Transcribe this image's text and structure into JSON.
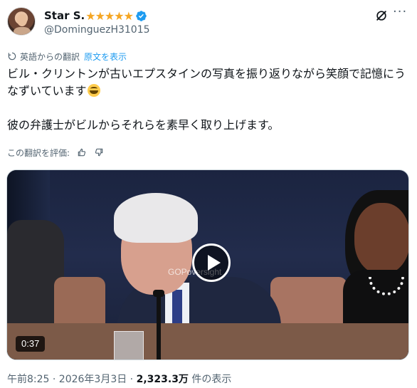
{
  "header": {
    "display_name": "Star S.",
    "stars": "★★★★★",
    "handle": "@DominguezH31015",
    "verified_color": "#1d9bf0"
  },
  "translation": {
    "label": "英語からの翻訳",
    "show_original": "原文を表示"
  },
  "tweet": {
    "line1": "ビル・クリントンが古いエプスタインの写真を振り返りながら笑顔で記憶にうなずいています",
    "line2": "彼の弁護士がビルからそれらを素早く取り上げます。"
  },
  "rating": {
    "label": "この翻訳を評価:"
  },
  "video": {
    "duration": "0:37",
    "watermark": "GOPoversight"
  },
  "meta": {
    "timestamp": "午前8:25 · 2026年3月3日 · ",
    "views": "2,323.3万",
    "views_suffix": " 件の表示"
  },
  "colors": {
    "accent": "#1d9bf0",
    "secondary_text": "#536471",
    "star": "#f5a623"
  }
}
